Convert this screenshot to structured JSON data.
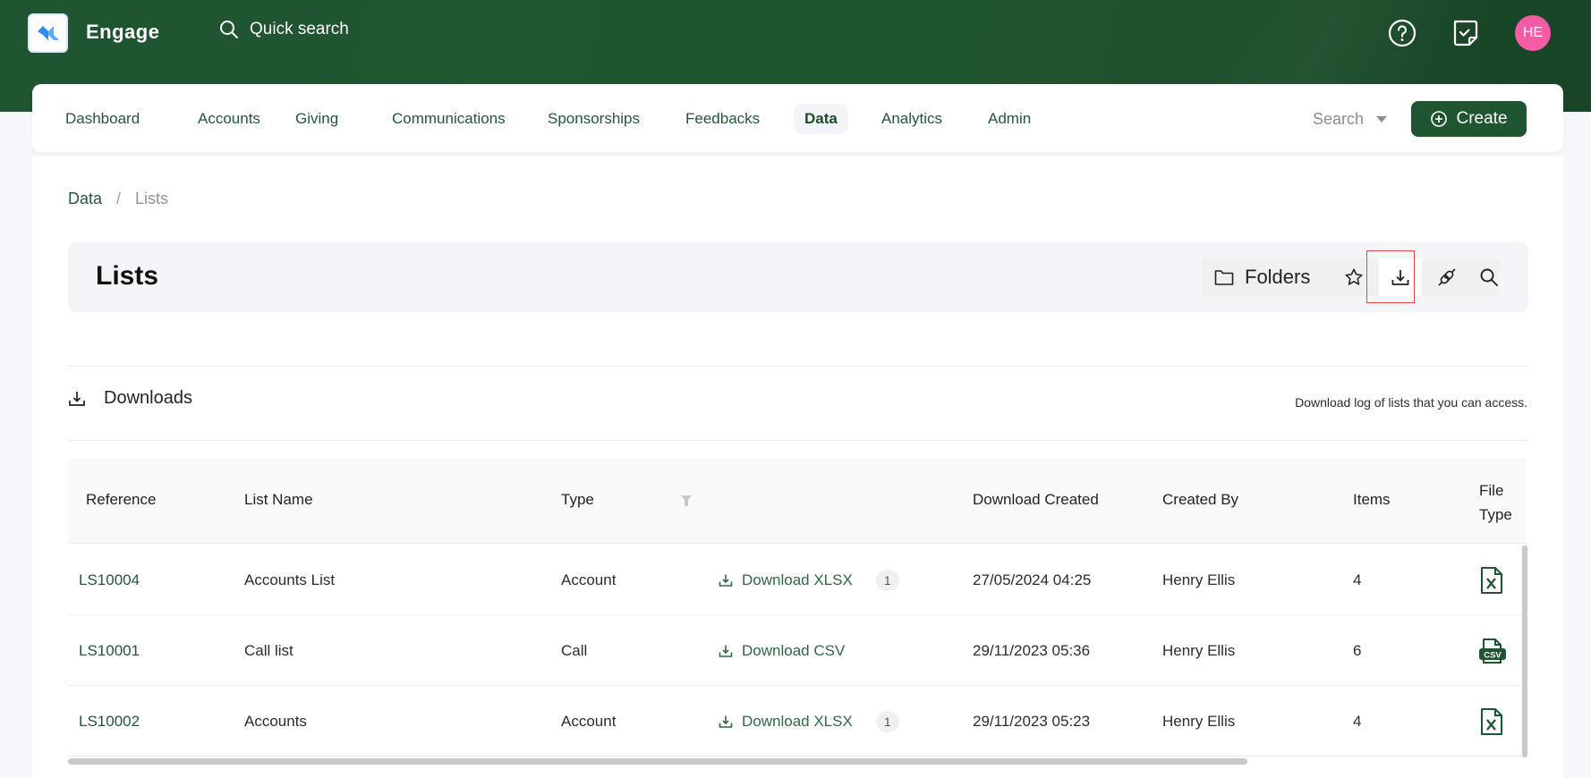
{
  "app": {
    "name": "Engage",
    "quick_search_label": "Quick search",
    "avatar_initials": "HE",
    "colors": {
      "brand_green": "#1f5530",
      "avatar_pink": "#f65ba6",
      "highlight_red": "#e0464a"
    }
  },
  "header_icons": [
    {
      "name": "help-icon"
    },
    {
      "name": "tasks-icon"
    }
  ],
  "nav": {
    "items": [
      {
        "label": "Dashboard",
        "active": false
      },
      {
        "label": "Accounts",
        "active": false
      },
      {
        "label": "Giving",
        "active": false
      },
      {
        "label": "Communications",
        "active": false
      },
      {
        "label": "Sponsorships",
        "active": false
      },
      {
        "label": "Feedbacks",
        "active": false
      },
      {
        "label": "Data",
        "active": true
      },
      {
        "label": "Analytics",
        "active": false
      },
      {
        "label": "Admin",
        "active": false
      }
    ],
    "search_label": "Search",
    "create_label": "Create"
  },
  "breadcrumb": {
    "items": [
      "Data",
      "Lists"
    ],
    "separator": "/"
  },
  "page": {
    "title": "Lists",
    "toolbar": {
      "folders_label": "Folders",
      "buttons": [
        "favorite",
        "downloads",
        "integrations",
        "search"
      ],
      "highlighted": "downloads"
    }
  },
  "downloads": {
    "title": "Downloads",
    "description": "Download log of lists that you can access."
  },
  "table": {
    "columns": [
      "Reference",
      "List Name",
      "Type",
      "",
      "Download Created",
      "Created By",
      "Items",
      "File Type"
    ],
    "rows": [
      {
        "reference": "LS10004",
        "list_name": "Accounts List",
        "type": "Account",
        "download_label": "Download XLSX",
        "count": "1",
        "created": "27/05/2024 04:25",
        "created_by": "Henry Ellis",
        "items": "4",
        "file_type": "xlsx"
      },
      {
        "reference": "LS10001",
        "list_name": "Call list",
        "type": "Call",
        "download_label": "Download CSV",
        "count": null,
        "created": "29/11/2023 05:36",
        "created_by": "Henry Ellis",
        "items": "6",
        "file_type": "csv"
      },
      {
        "reference": "LS10002",
        "list_name": "Accounts",
        "type": "Account",
        "download_label": "Download XLSX",
        "count": "1",
        "created": "29/11/2023 05:23",
        "created_by": "Henry Ellis",
        "items": "4",
        "file_type": "xlsx"
      }
    ]
  }
}
